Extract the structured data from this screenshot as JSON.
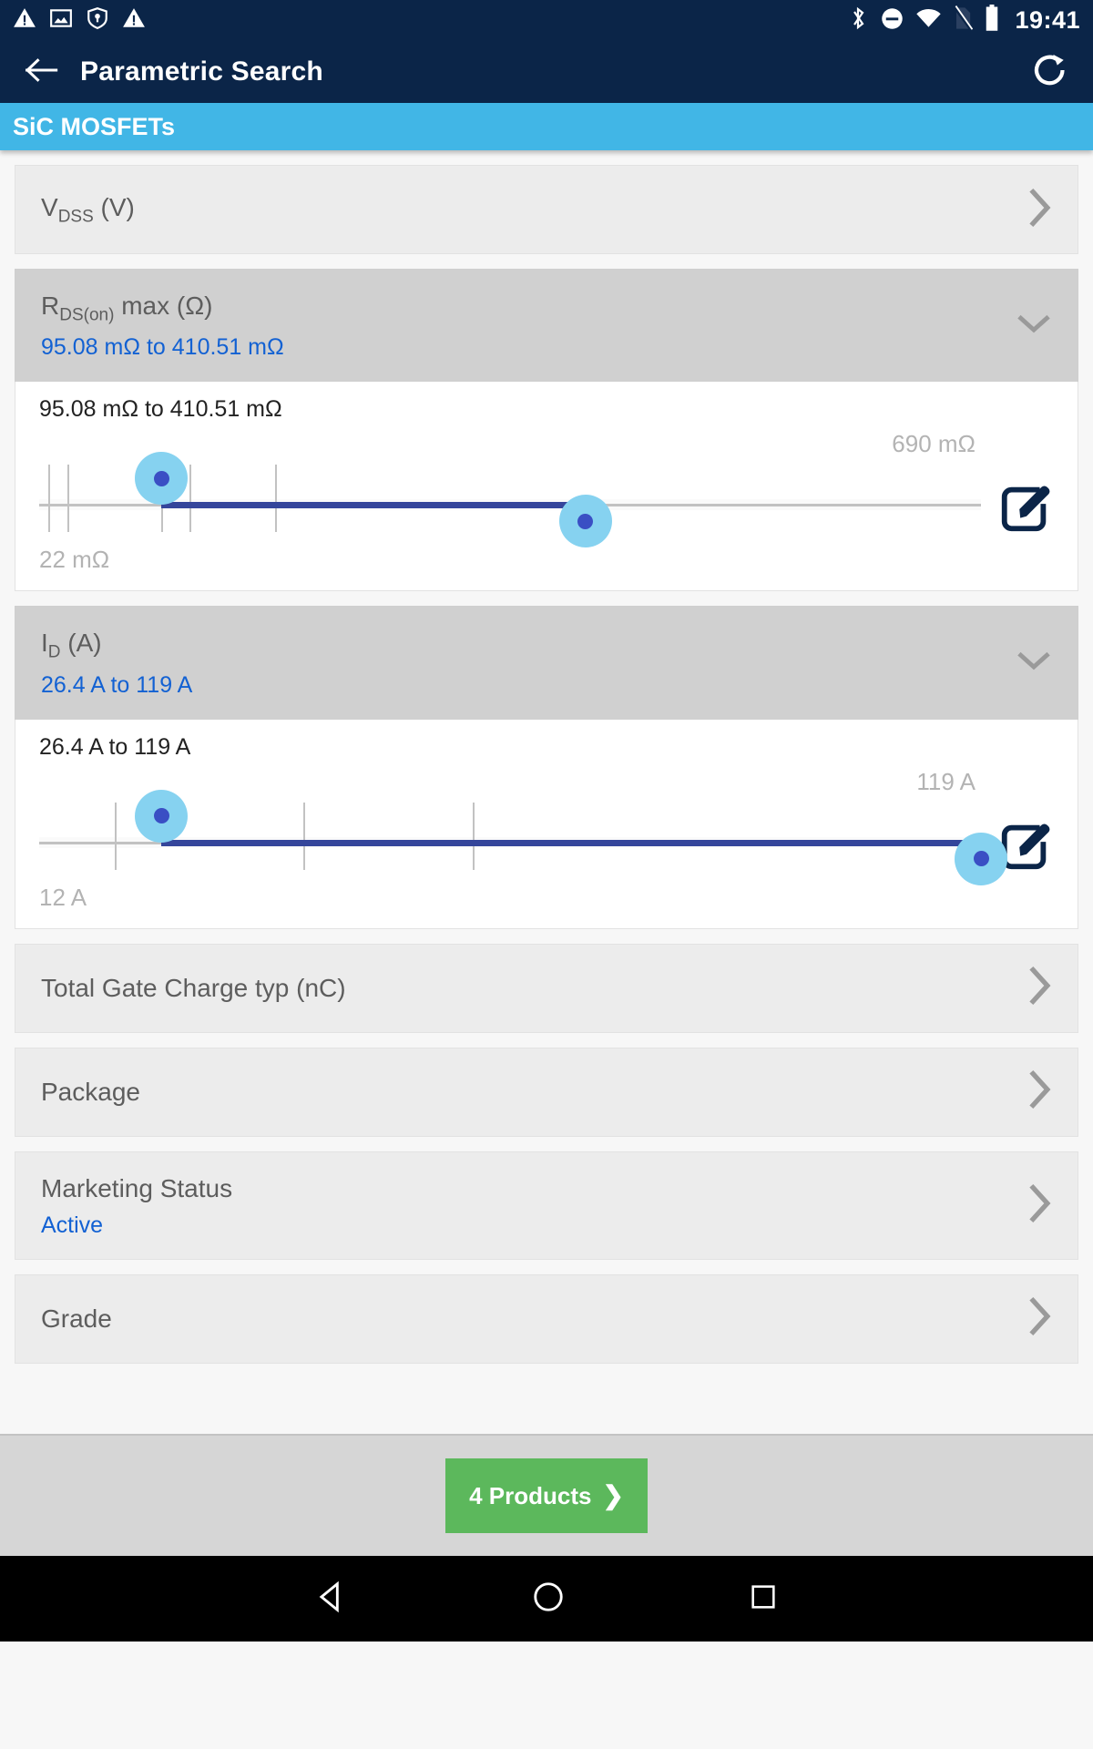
{
  "statusbar": {
    "time": "19:41",
    "left_icons": [
      "warning-triangle-icon",
      "screenshot-image-icon",
      "vpn-key-shield-icon",
      "warning-triangle-icon"
    ],
    "right_icons": [
      "bluetooth-icon",
      "do-not-disturb-icon",
      "wifi-icon",
      "no-sim-icon",
      "battery-full-icon"
    ]
  },
  "appbar": {
    "back_label": "back-arrow",
    "title": "Parametric Search",
    "refresh_label": "refresh"
  },
  "subheader": {
    "title": "SiC MOSFETs"
  },
  "filters": [
    {
      "id": "vdss",
      "label_main": "V",
      "label_sub": "DSS",
      "label_tail": " (V)",
      "value": "",
      "state": "collapsed",
      "chevron": "chevron-right-icon"
    },
    {
      "id": "rdson",
      "label_main": "R",
      "label_sub": "DS(on)",
      "label_tail": " max (Ω)",
      "value": "95.08 mΩ to 410.51 mΩ",
      "state": "expanded",
      "chevron": "chevron-down-icon",
      "panel": {
        "range_text": "95.08 mΩ to 410.51 mΩ",
        "min_label": "22 mΩ",
        "max_label": "690 mΩ",
        "edit_icon": "edit-pencil-icon",
        "slider": {
          "min": 22,
          "max": 690,
          "low": 95.08,
          "high": 410.51,
          "low_pct": 13,
          "high_pct": 58,
          "ticks_pct": [
            1,
            3,
            13,
            16,
            25
          ]
        }
      }
    },
    {
      "id": "id",
      "label_main": "I",
      "label_sub": "D",
      "label_tail": " (A)",
      "value": "26.4 A to 119 A",
      "state": "expanded",
      "chevron": "chevron-down-icon",
      "panel": {
        "range_text": "26.4 A to 119 A",
        "min_label": "12 A",
        "max_label": "119 A",
        "edit_icon": "edit-pencil-icon",
        "slider": {
          "min": 12,
          "max": 119,
          "low": 26.4,
          "high": 119,
          "low_pct": 13,
          "high_pct": 100,
          "ticks_pct": [
            8,
            28,
            46
          ]
        }
      }
    },
    {
      "id": "qg",
      "label_main": "Total Gate Charge typ (nC)",
      "label_sub": "",
      "label_tail": "",
      "value": "",
      "state": "collapsed",
      "chevron": "chevron-right-icon"
    },
    {
      "id": "package",
      "label_main": "Package",
      "label_sub": "",
      "label_tail": "",
      "value": "",
      "state": "collapsed",
      "chevron": "chevron-right-icon"
    },
    {
      "id": "marketing-status",
      "label_main": "Marketing Status",
      "label_sub": "",
      "label_tail": "",
      "value": "Active",
      "state": "collapsed",
      "chevron": "chevron-right-icon"
    },
    {
      "id": "grade",
      "label_main": "Grade",
      "label_sub": "",
      "label_tail": "",
      "value": "",
      "state": "collapsed",
      "chevron": "chevron-right-icon"
    }
  ],
  "footer": {
    "products_label": "4 Products",
    "products_chevron": "❯"
  },
  "navbar": {
    "back": "nav-back-triangle",
    "home": "nav-home-circle",
    "recents": "nav-recents-square"
  },
  "colors": {
    "appbar": "#0b2548",
    "subheader": "#41b6e6",
    "accent_link": "#1261d3",
    "slider_active": "#35469b",
    "thumb": "#86d2f0",
    "products_green": "#5cb85c"
  }
}
